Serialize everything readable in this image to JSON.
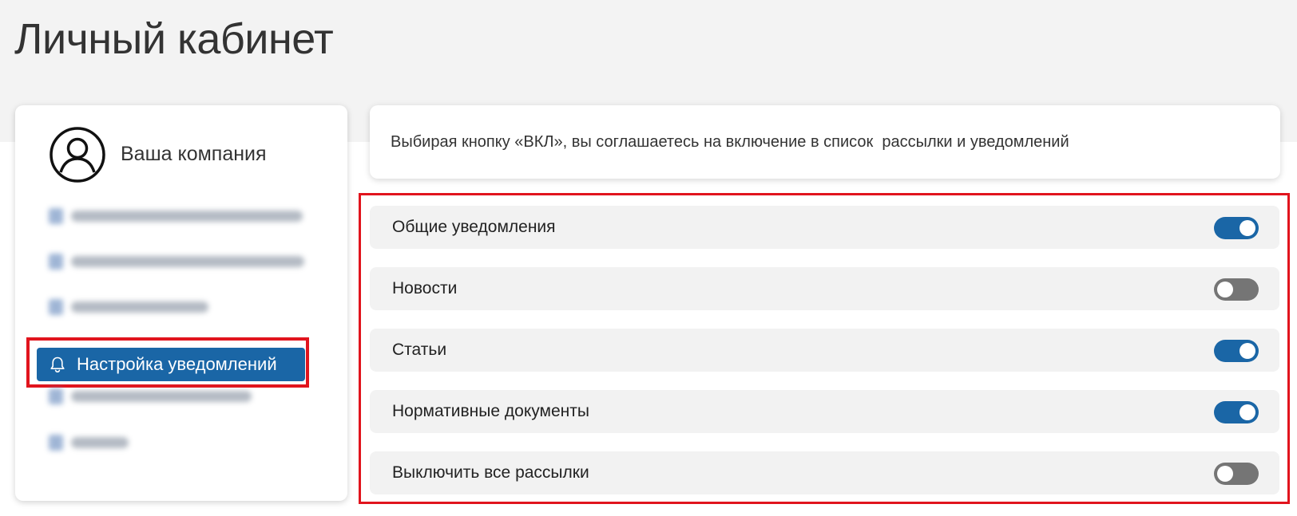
{
  "page": {
    "title": "Личный кабинет"
  },
  "profile": {
    "name": "Ваша компания",
    "icon": "user-circle-icon"
  },
  "sidebar": {
    "active_item": {
      "label": "Настройка уведомлений",
      "icon": "bell-icon"
    },
    "blurred_item_icons": [
      "star-icon",
      "building-icon",
      "home-icon",
      "grid-icon",
      "exit-icon"
    ]
  },
  "info": {
    "text": "Выбирая кнопку «ВКЛ», вы соглашаетесь на включение в список  рассылки и уведомлений"
  },
  "settings": [
    {
      "label": "Общие уведомления",
      "enabled": true
    },
    {
      "label": "Новости",
      "enabled": false
    },
    {
      "label": "Статьи",
      "enabled": true
    },
    {
      "label": "Нормативные документы",
      "enabled": true
    },
    {
      "label": "Выключить все рассылки",
      "enabled": false
    }
  ],
  "colors": {
    "accent": "#1a66a6",
    "toggle_off": "#757575",
    "highlight_frame": "#e1141d",
    "background_band": "#f3f3f3",
    "row_background": "#f2f2f2"
  }
}
